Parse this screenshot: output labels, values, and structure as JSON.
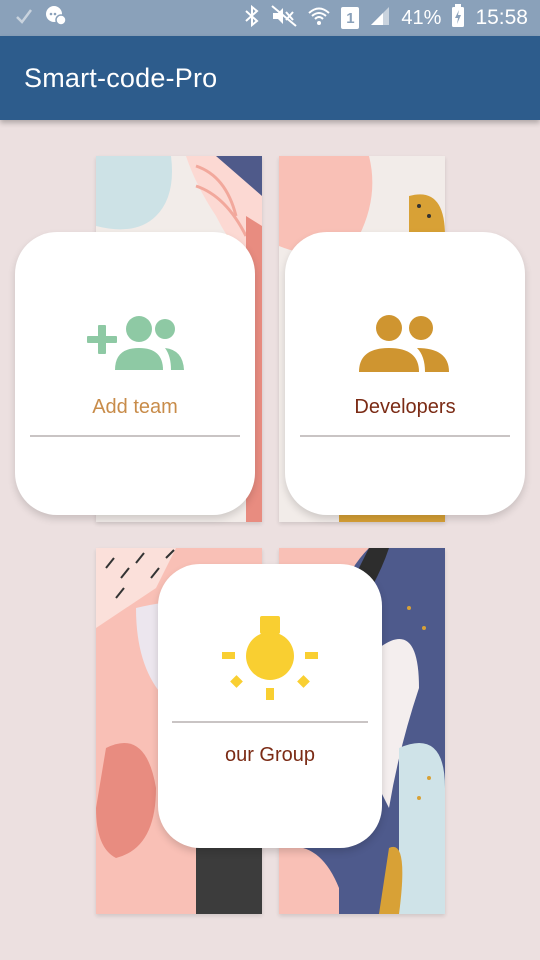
{
  "status_bar": {
    "battery_percent": "41%",
    "time": "15:58",
    "sim_slot": "1"
  },
  "app_bar": {
    "title": "Smart-code-Pro"
  },
  "cards": {
    "add_team": {
      "label": "Add team",
      "icon": "add-group-icon",
      "color": "#8ec9a4",
      "label_color": "#c88c4a"
    },
    "developers": {
      "label": "Developers",
      "icon": "group-icon",
      "color": "#cf9530",
      "label_color": "#7b2b15"
    },
    "our_group": {
      "label": "our Group",
      "icon": "lightbulb-icon",
      "color": "#f9cf31",
      "label_color": "#7b2b15"
    }
  },
  "colors": {
    "status_bar": "#8aa1ba",
    "app_bar": "#2d5c8c",
    "background": "#ece0e0"
  }
}
